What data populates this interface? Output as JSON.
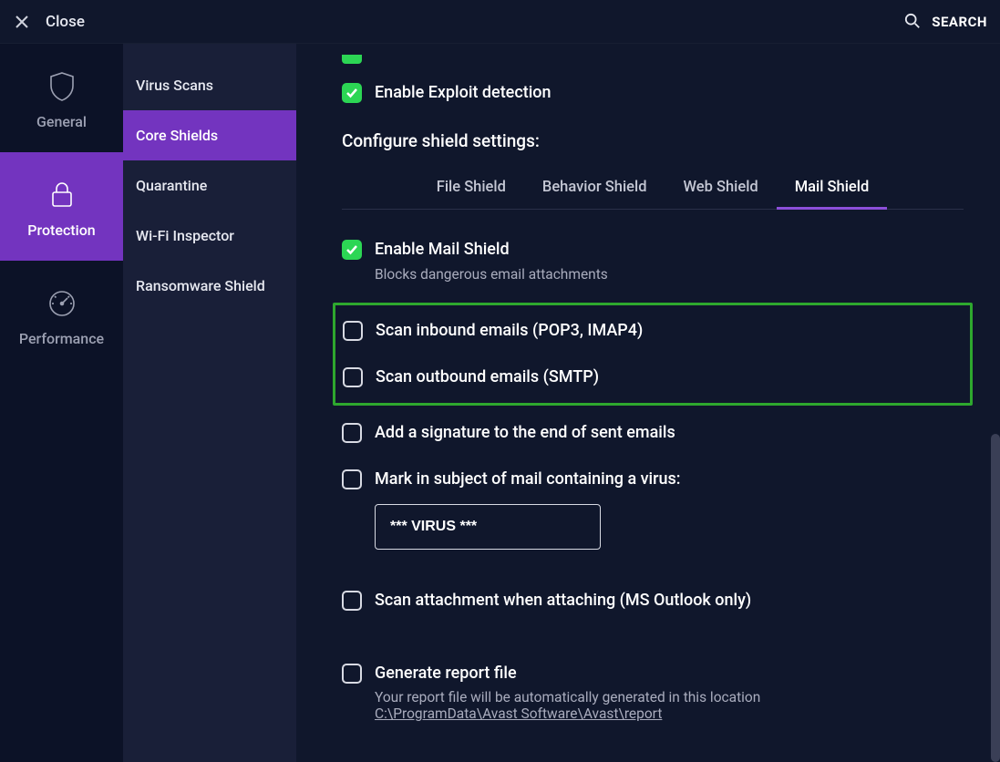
{
  "topbar": {
    "close_label": "Close",
    "search_label": "SEARCH"
  },
  "nav": {
    "general": "General",
    "protection": "Protection",
    "performance": "Performance"
  },
  "subnav": {
    "virus_scans": "Virus Scans",
    "core_shields": "Core Shields",
    "quarantine": "Quarantine",
    "wifi_inspector": "Wi-Fi Inspector",
    "ransomware_shield": "Ransomware Shield"
  },
  "main": {
    "enable_exploit": "Enable Exploit detection",
    "configure_title": "Configure shield settings:",
    "tabs": {
      "file": "File Shield",
      "behavior": "Behavior Shield",
      "web": "Web Shield",
      "mail": "Mail Shield"
    },
    "enable_mail": {
      "label": "Enable Mail Shield",
      "desc": "Blocks dangerous email attachments"
    },
    "scan_inbound": "Scan inbound emails (POP3, IMAP4)",
    "scan_outbound": "Scan outbound emails (SMTP)",
    "add_signature": "Add a signature to the end of sent emails",
    "mark_subject": "Mark in subject of mail containing a virus:",
    "virus_value": "*** VIRUS ***",
    "scan_attachment": "Scan attachment when attaching (MS Outlook only)",
    "generate_report": {
      "label": "Generate report file",
      "desc": "Your report file will be automatically generated in this location",
      "path": "C:\\ProgramData\\Avast Software\\Avast\\report"
    }
  }
}
